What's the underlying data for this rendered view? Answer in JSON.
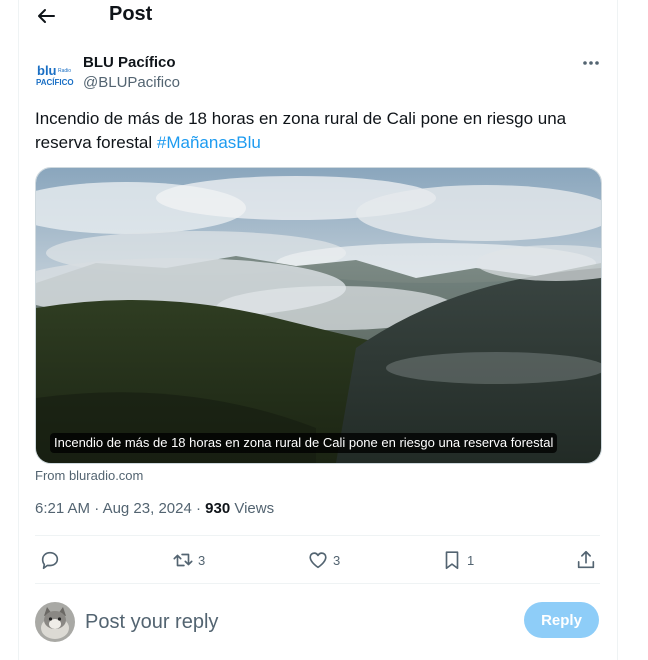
{
  "header": {
    "title": "Post",
    "back_icon": "arrow-left-icon"
  },
  "author": {
    "display_name": "BLU Pacífico",
    "handle": "@BLUPacifico",
    "logo_text_top": "blu",
    "logo_text_bottom": "PACÍFICO"
  },
  "tweet": {
    "text": "Incendio de más de 18 horas en zona rural de Cali pone en riesgo una reserva forestal ",
    "hashtag": "#MañanasBlu"
  },
  "media": {
    "caption": "Incendio de más de 18 horas en zona rural de Cali pone en riesgo una reserva forestal",
    "source": "From bluradio.com"
  },
  "meta": {
    "time": "6:21 AM",
    "date": "Aug 23, 2024",
    "views_count": "930",
    "views_label": "Views",
    "separator": "·"
  },
  "actions": {
    "reply": {
      "icon": "reply-icon",
      "count": ""
    },
    "retweet": {
      "icon": "retweet-icon",
      "count": "3"
    },
    "like": {
      "icon": "heart-icon",
      "count": "3"
    },
    "bookmark": {
      "icon": "bookmark-icon",
      "count": "1"
    },
    "share": {
      "icon": "share-icon"
    }
  },
  "reply_box": {
    "placeholder": "Post your reply",
    "button_label": "Reply"
  },
  "colors": {
    "accent": "#1d9bf0",
    "reply_button_disabled": "#8ecdf8",
    "secondary_text": "#536471",
    "logo_blue": "#1a6fc4"
  }
}
